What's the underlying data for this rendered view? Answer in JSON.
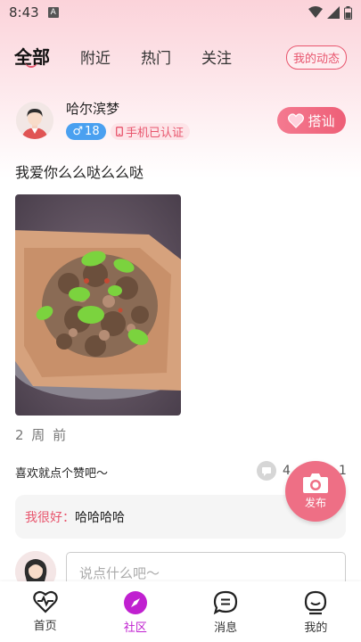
{
  "status_bar": {
    "time": "8:43",
    "notification_glyph": "A"
  },
  "tabs": [
    {
      "label": "全部",
      "active": true
    },
    {
      "label": "附近",
      "active": false
    },
    {
      "label": "热门",
      "active": false
    },
    {
      "label": "关注",
      "active": false
    }
  ],
  "header": {
    "my_activity_label": "我的动态"
  },
  "post": {
    "username": "哈尔滨梦",
    "gender_symbol": "♂",
    "age": "18",
    "verify_label": "手机已认证",
    "flirt_label": "搭讪",
    "text": "我爱你么么哒么么哒",
    "time_ago": "2 周 前",
    "like_prompt": "喜欢就点个赞吧～",
    "comment_count": "4",
    "like_count": "1",
    "comments": [
      {
        "author": "我很好：",
        "content": "哈哈哈哈"
      }
    ]
  },
  "comment_input": {
    "placeholder": "说点什么吧～"
  },
  "fab": {
    "label": "发布"
  },
  "bottom_nav": [
    {
      "label": "首页",
      "icon": "heartbeat-icon",
      "active": false
    },
    {
      "label": "社区",
      "icon": "compass-icon",
      "active": true
    },
    {
      "label": "消息",
      "icon": "message-icon",
      "active": false
    },
    {
      "label": "我的",
      "icon": "profile-icon",
      "active": false
    }
  ],
  "colors": {
    "accent": "#e8556d",
    "nav_active": "#c020d0",
    "gender_blue": "#4aa0f0"
  }
}
